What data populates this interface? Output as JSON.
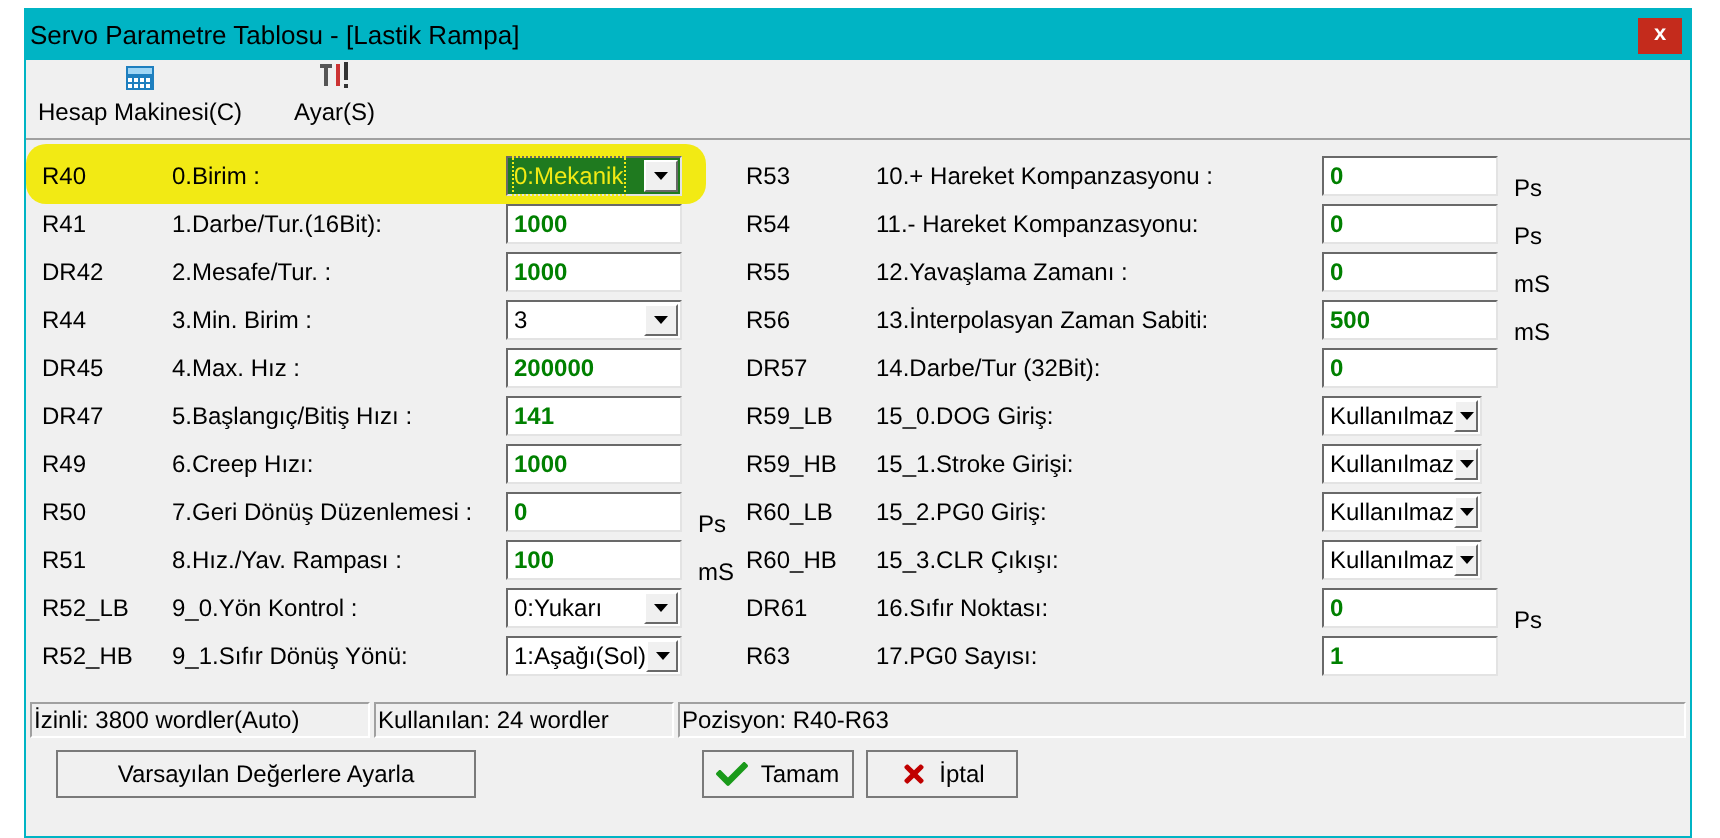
{
  "window": {
    "title": "Servo Parametre Tablosu - [Lastik Rampa]",
    "close": "x"
  },
  "toolbar": [
    {
      "label": "Hesap Makinesi(C)",
      "kind": "calculator"
    },
    {
      "label": "Ayar(S)",
      "kind": "tools"
    }
  ],
  "columns": [
    {
      "rows": [
        {
          "register": "R40",
          "label": "0.Birim :",
          "kind": "select",
          "value": "0:Mekanik",
          "highlighted": true,
          "focused": true
        },
        {
          "register": "R41",
          "label": "1.Darbe/Tur.(16Bit):",
          "kind": "number",
          "value": "1000",
          "highlighted": false,
          "focused": false
        },
        {
          "register": "DR42",
          "label": "2.Mesafe/Tur. :",
          "kind": "number",
          "value": "1000",
          "highlighted": false,
          "focused": false
        },
        {
          "register": "R44",
          "label": "3.Min. Birim :",
          "kind": "select",
          "value": "3",
          "highlighted": false,
          "focused": false
        },
        {
          "register": "DR45",
          "label": "4.Max. Hız :",
          "kind": "number",
          "value": "200000",
          "highlighted": false,
          "focused": false
        },
        {
          "register": "DR47",
          "label": "5.Başlangıç/Bitiş Hızı :",
          "kind": "number",
          "value": "141",
          "highlighted": false,
          "focused": false
        },
        {
          "register": "R49",
          "label": "6.Creep Hızı:",
          "kind": "number",
          "value": "1000",
          "highlighted": false,
          "focused": false
        },
        {
          "register": "R50",
          "label": "7.Geri Dönüş Düzenlemesi :",
          "kind": "number",
          "value": "0",
          "unit": "Ps",
          "highlighted": false,
          "focused": false
        },
        {
          "register": "R51",
          "label": "8.Hız./Yav. Rampası :",
          "kind": "number",
          "value": "100",
          "unit": "mS",
          "highlighted": false,
          "focused": false
        },
        {
          "register": "R52_LB",
          "label": "9_0.Yön Kontrol :",
          "kind": "select",
          "value": "0:Yukarı",
          "highlighted": false,
          "focused": false
        },
        {
          "register": "R52_HB",
          "label": "9_1.Sıfır Dönüş Yönü:",
          "kind": "select",
          "value": "1:Aşağı(Sol)",
          "highlighted": false,
          "focused": false
        }
      ]
    },
    {
      "rows": [
        {
          "register": "R53",
          "label": "10.+ Hareket Kompanzasyonu :",
          "kind": "number",
          "value": "0",
          "unit": "Ps",
          "highlighted": false,
          "focused": false
        },
        {
          "register": "R54",
          "label": "11.- Hareket Kompanzasyonu:",
          "kind": "number",
          "value": "0",
          "unit": "Ps",
          "highlighted": false,
          "focused": false
        },
        {
          "register": "R55",
          "label": "12.Yavaşlama Zamanı :",
          "kind": "number",
          "value": "0",
          "unit": "mS",
          "highlighted": false,
          "focused": false
        },
        {
          "register": "R56",
          "label": "13.İnterpolasyan Zaman Sabiti:",
          "kind": "number",
          "value": "500",
          "unit": "mS",
          "highlighted": false,
          "focused": false
        },
        {
          "register": "DR57",
          "label": "14.Darbe/Tur (32Bit):",
          "kind": "number",
          "value": "0",
          "highlighted": false,
          "focused": false
        },
        {
          "register": "R59_LB",
          "label": "15_0.DOG Giriş:",
          "kind": "select",
          "value": "Kullanılmaz",
          "highlighted": false,
          "focused": false
        },
        {
          "register": "R59_HB",
          "label": "15_1.Stroke Girişi:",
          "kind": "select",
          "value": "Kullanılmaz",
          "highlighted": false,
          "focused": false
        },
        {
          "register": "R60_LB",
          "label": "15_2.PG0 Giriş:",
          "kind": "select",
          "value": "Kullanılmaz",
          "highlighted": false,
          "focused": false
        },
        {
          "register": "R60_HB",
          "label": "15_3.CLR Çıkışı:",
          "kind": "select",
          "value": "Kullanılmaz",
          "highlighted": false,
          "focused": false
        },
        {
          "register": "DR61",
          "label": "16.Sıfır Noktası:",
          "kind": "number",
          "value": "0",
          "unit": "Ps",
          "highlighted": false,
          "focused": false
        },
        {
          "register": "R63",
          "label": "17.PG0 Sayısı:",
          "kind": "number",
          "value": "1",
          "highlighted": false,
          "focused": false
        }
      ]
    }
  ],
  "status_bar": [
    "İzinli: 3800 wordler(Auto)",
    "Kullanılan: 24 wordler",
    "Pozisyon: R40-R63"
  ],
  "buttons": [
    {
      "label": "Varsayılan Değerlere Ayarla",
      "kind": "plain"
    },
    {
      "label": "Tamam",
      "kind": "ok"
    },
    {
      "label": "İptal",
      "kind": "cancel"
    }
  ]
}
